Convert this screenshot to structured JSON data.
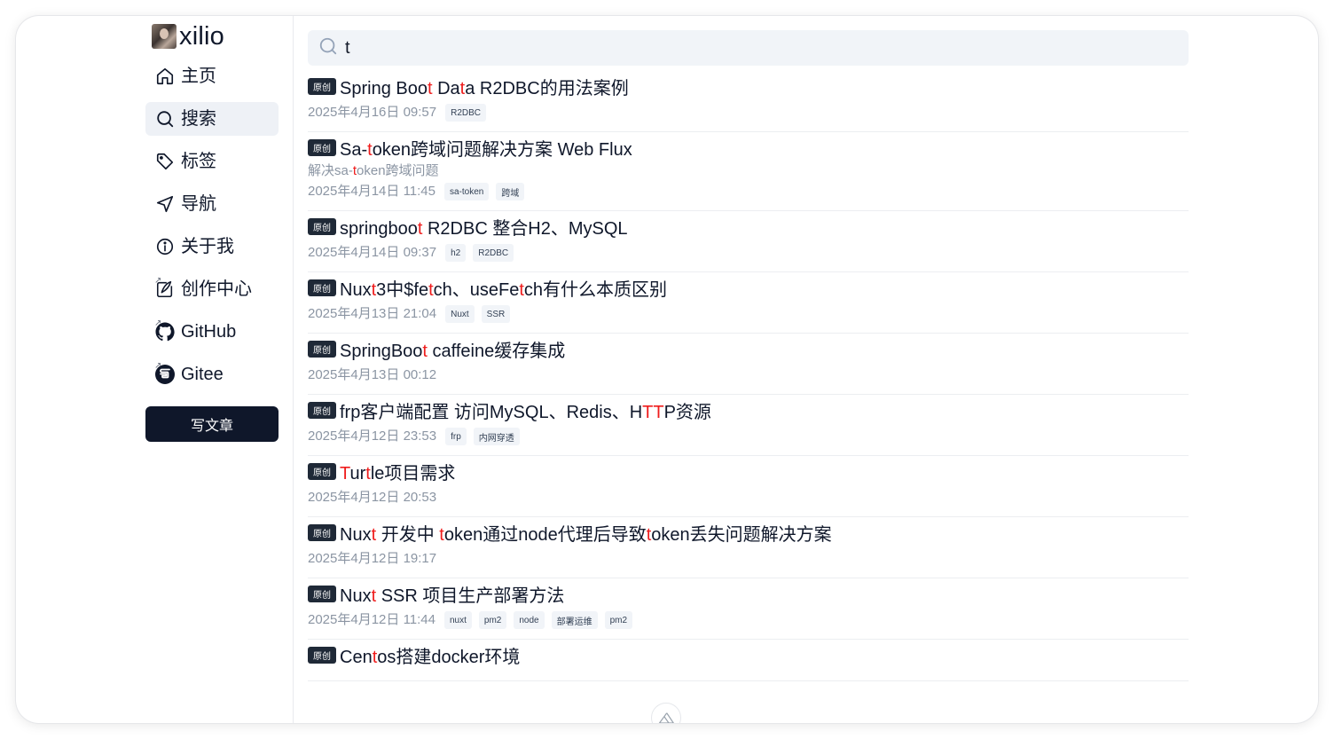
{
  "brand": {
    "name": "xilio"
  },
  "nav": [
    {
      "label": "主页",
      "icon": "home-icon",
      "active": false,
      "external": false
    },
    {
      "label": "搜索",
      "icon": "search-icon",
      "active": true,
      "external": false
    },
    {
      "label": "标签",
      "icon": "tag-icon",
      "active": false,
      "external": false
    },
    {
      "label": "导航",
      "icon": "navigation-icon",
      "active": false,
      "external": false
    },
    {
      "label": "关于我",
      "icon": "info-icon",
      "active": false,
      "external": false
    },
    {
      "label": "创作中心",
      "icon": "edit-icon",
      "active": false,
      "external": true
    },
    {
      "label": "GitHub",
      "icon": "github-icon",
      "active": false,
      "external": true
    },
    {
      "label": "Gitee",
      "icon": "gitee-icon",
      "active": false,
      "external": true
    }
  ],
  "write_button": "写文章",
  "search": {
    "value": "t",
    "placeholder": ""
  },
  "external_mark": "↗",
  "results": [
    {
      "badge": "原创",
      "title": [
        [
          "Spring Boo",
          0
        ],
        [
          "t",
          1
        ],
        [
          " Da",
          0
        ],
        [
          "t",
          1
        ],
        [
          "a R2DBC的用法案例",
          0
        ]
      ],
      "desc": null,
      "date": "2025年4月16日 09:57",
      "tags": [
        "R2DBC"
      ]
    },
    {
      "badge": "原创",
      "title": [
        [
          "Sa-",
          0
        ],
        [
          "t",
          1
        ],
        [
          "oken跨域问题解决方案 Web Flux",
          0
        ]
      ],
      "desc": [
        [
          "解决sa-",
          0
        ],
        [
          "t",
          1
        ],
        [
          "oken跨域问题",
          0
        ]
      ],
      "date": "2025年4月14日 11:45",
      "tags": [
        "sa-token",
        "跨域"
      ]
    },
    {
      "badge": "原创",
      "title": [
        [
          "springboo",
          0
        ],
        [
          "t",
          1
        ],
        [
          " R2DBC 整合H2、MySQL",
          0
        ]
      ],
      "desc": null,
      "date": "2025年4月14日 09:37",
      "tags": [
        "h2",
        "R2DBC"
      ]
    },
    {
      "badge": "原创",
      "title": [
        [
          "Nux",
          0
        ],
        [
          "t",
          1
        ],
        [
          "3中$fe",
          0
        ],
        [
          "t",
          1
        ],
        [
          "ch、useFe",
          0
        ],
        [
          "t",
          1
        ],
        [
          "ch有什么本质区别",
          0
        ]
      ],
      "desc": null,
      "date": "2025年4月13日 21:04",
      "tags": [
        "Nuxt",
        "SSR"
      ]
    },
    {
      "badge": "原创",
      "title": [
        [
          "SpringBoo",
          0
        ],
        [
          "t",
          1
        ],
        [
          " caffeine缓存集成",
          0
        ]
      ],
      "desc": null,
      "date": "2025年4月13日 00:12",
      "tags": []
    },
    {
      "badge": "原创",
      "title": [
        [
          "frp客户端配置 访问MySQL、Redis、H",
          0
        ],
        [
          "TT",
          1
        ],
        [
          "P资源",
          0
        ]
      ],
      "desc": null,
      "date": "2025年4月12日 23:53",
      "tags": [
        "frp",
        "内网穿透"
      ]
    },
    {
      "badge": "原创",
      "title": [
        [
          "T",
          1
        ],
        [
          "ur",
          0
        ],
        [
          "t",
          1
        ],
        [
          "le项目需求",
          0
        ]
      ],
      "desc": null,
      "date": "2025年4月12日 20:53",
      "tags": []
    },
    {
      "badge": "原创",
      "title": [
        [
          "Nux",
          0
        ],
        [
          "t",
          1
        ],
        [
          " 开发中 ",
          0
        ],
        [
          "t",
          1
        ],
        [
          "oken通过node代理后导致",
          0
        ],
        [
          "t",
          1
        ],
        [
          "oken丢失问题解决方案",
          0
        ]
      ],
      "desc": null,
      "date": "2025年4月12日 19:17",
      "tags": []
    },
    {
      "badge": "原创",
      "title": [
        [
          "Nux",
          0
        ],
        [
          "t",
          1
        ],
        [
          " SSR 项目生产部署方法",
          0
        ]
      ],
      "desc": null,
      "date": "2025年4月12日 11:44",
      "tags": [
        "nuxt",
        "pm2",
        "node",
        "部署运维",
        "pm2"
      ]
    },
    {
      "badge": "原创",
      "title": [
        [
          "Cen",
          0
        ],
        [
          "t",
          1
        ],
        [
          "os搭建docker环境",
          0
        ]
      ],
      "desc": null,
      "date": "",
      "tags": []
    }
  ],
  "colors": {
    "highlight": "#ef1c1c",
    "primary": "#0f172a",
    "muted": "#8b95a3",
    "tag_bg": "#f1f4f8"
  }
}
